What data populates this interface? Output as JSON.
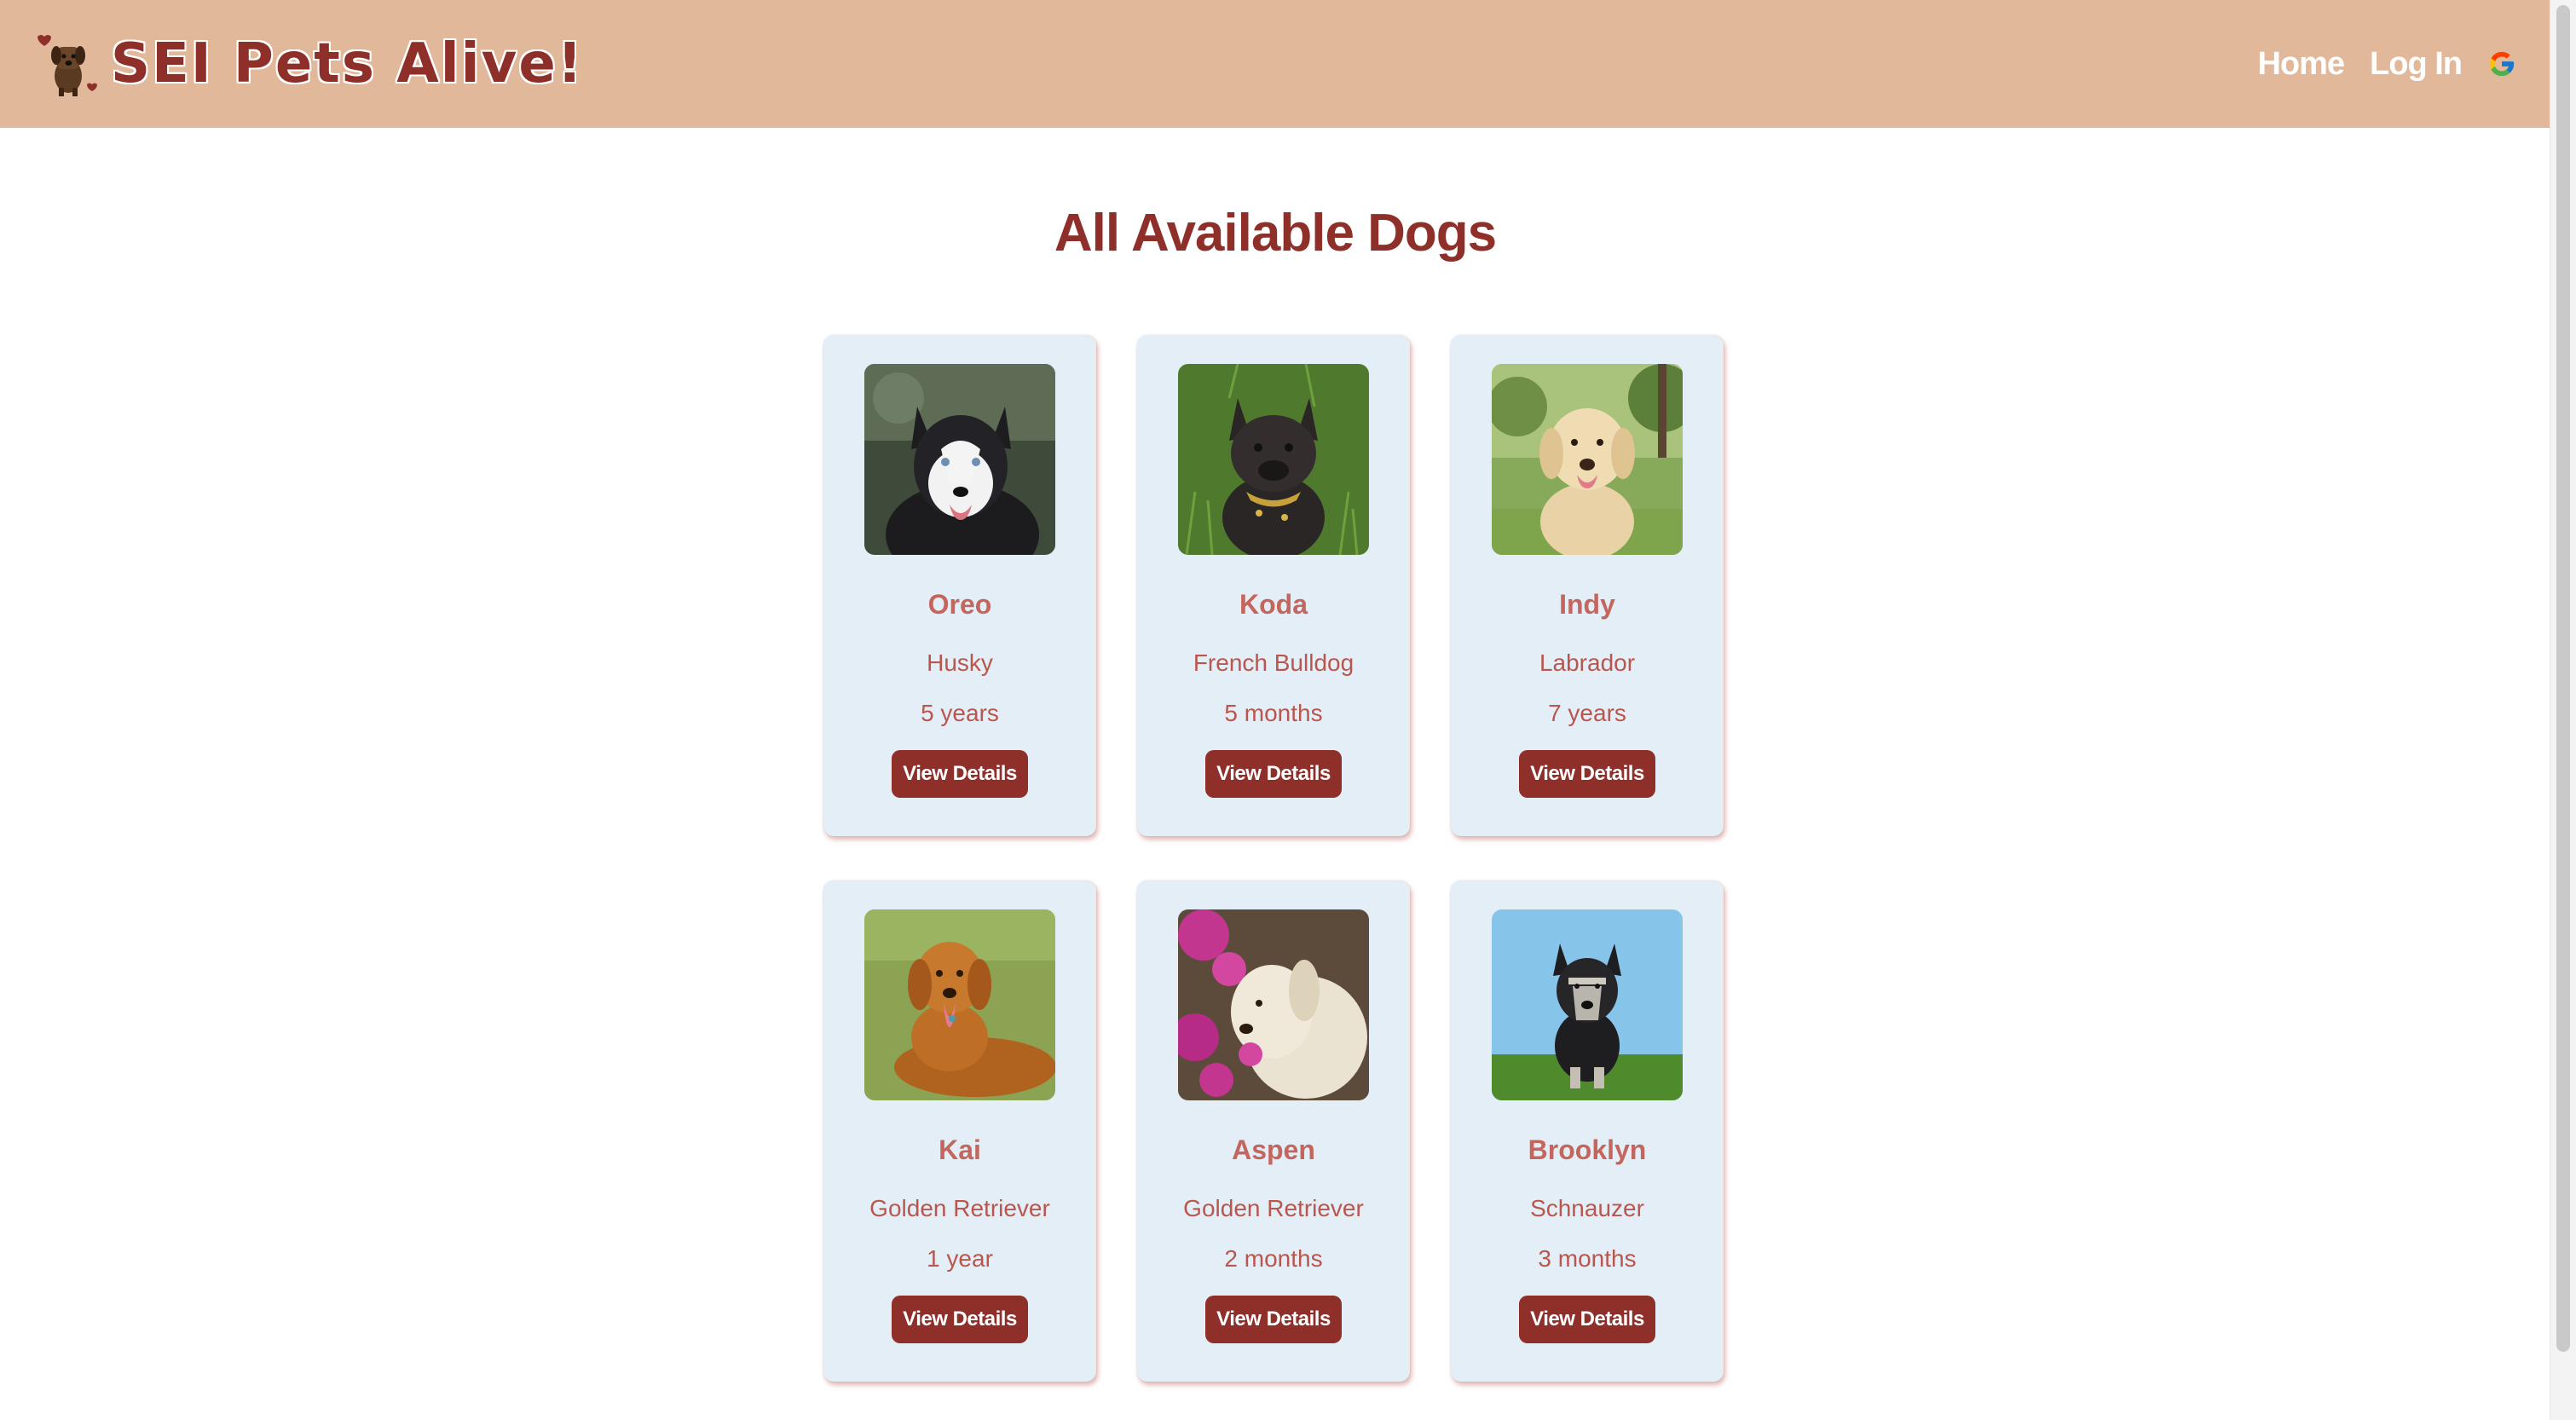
{
  "brand": {
    "title": "SEI Pets Alive!"
  },
  "nav": {
    "home_label": "Home",
    "login_label": "Log In",
    "google_icon": "google-icon"
  },
  "main": {
    "title": "All Available Dogs"
  },
  "colors": {
    "navbar": "#e2b89b",
    "accent": "#8e2f2a",
    "card": "#e3eef7",
    "text": "#b9564e"
  },
  "dogs": [
    {
      "name": "Oreo",
      "breed": "Husky",
      "age": "5 years",
      "button_label": "View Details",
      "photo": "husky-photo"
    },
    {
      "name": "Koda",
      "breed": "French Bulldog",
      "age": "5 months",
      "button_label": "View Details",
      "photo": "french-bulldog-photo"
    },
    {
      "name": "Indy",
      "breed": "Labrador",
      "age": "7 years",
      "button_label": "View Details",
      "photo": "labrador-photo"
    },
    {
      "name": "Kai",
      "breed": "Golden Retriever",
      "age": "1 year",
      "button_label": "View Details",
      "photo": "golden-retriever-photo"
    },
    {
      "name": "Aspen",
      "breed": "Golden Retriever",
      "age": "2 months",
      "button_label": "View Details",
      "photo": "golden-retriever-puppy-photo"
    },
    {
      "name": "Brooklyn",
      "breed": "Schnauzer",
      "age": "3 months",
      "button_label": "View Details",
      "photo": "schnauzer-photo"
    }
  ]
}
